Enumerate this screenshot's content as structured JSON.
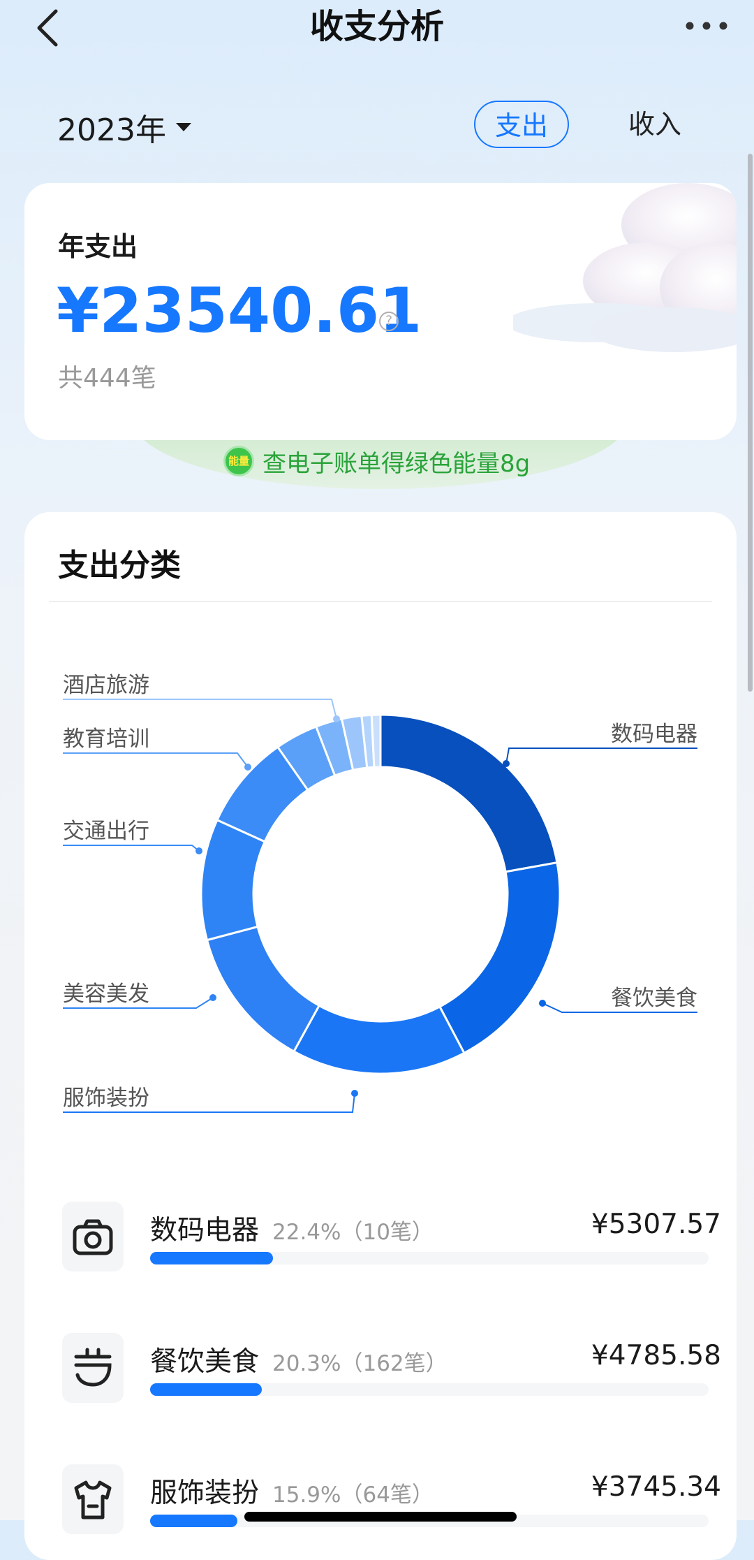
{
  "header": {
    "title": "收支分析",
    "back_icon": "chevron-left-icon",
    "more_icon": "more-icon"
  },
  "filter": {
    "year": "2023年",
    "tabs": [
      {
        "label": "支出",
        "active": true
      },
      {
        "label": "收入",
        "active": false
      }
    ]
  },
  "summary": {
    "label": "年支出",
    "amount": "¥23540.61",
    "count": "共444笔",
    "help_icon": "?"
  },
  "energy": {
    "icon_text": "能量",
    "text": "查电子账单得绿色能量8g"
  },
  "category": {
    "title": "支出分类",
    "labels": [
      "酒店旅游",
      "教育培训",
      "交通出行",
      "美容美发",
      "服饰装扮",
      "数码电器",
      "餐饮美食"
    ],
    "rows": [
      {
        "icon": "camera-icon",
        "name": "数码电器",
        "percent": "22.4%",
        "count": "（10笔）",
        "amount": "¥5307.57",
        "bar": 0.224
      },
      {
        "icon": "bowl-icon",
        "name": "餐饮美食",
        "percent": "20.3%",
        "count": "（162笔）",
        "amount": "¥4785.58",
        "bar": 0.203
      },
      {
        "icon": "shirt-icon",
        "name": "服饰装扮",
        "percent": "15.9%",
        "count": "（64笔）",
        "amount": "¥3745.34",
        "bar": 0.159
      }
    ]
  },
  "colors": {
    "accent": "#1677ff",
    "energy_green": "#2aa33a"
  },
  "chart_data": {
    "type": "pie",
    "donut": true,
    "series": [
      {
        "name": "数码电器",
        "value": 22.4,
        "color": "#0750bd"
      },
      {
        "name": "餐饮美食",
        "value": 20.3,
        "color": "#0a66e6"
      },
      {
        "name": "服饰装扮",
        "value": 15.9,
        "color": "#1a76f5"
      },
      {
        "value": 13.0,
        "color": "#2e80f5"
      },
      {
        "name": "美容美发",
        "value": 11.0,
        "color": "#2e84f5"
      },
      {
        "name": "交通出行",
        "value": 8.6,
        "color": "#3b8cf7"
      },
      {
        "name": "教育培训",
        "value": 3.9,
        "color": "#5aa0f8"
      },
      {
        "value": 2.4,
        "color": "#7ab3f9"
      },
      {
        "name": "酒店旅游",
        "value": 1.8,
        "color": "#9cc6fb"
      },
      {
        "value": 0.9,
        "color": "#b3d4fc"
      },
      {
        "value": 0.8,
        "color": "#cadffc"
      }
    ]
  }
}
